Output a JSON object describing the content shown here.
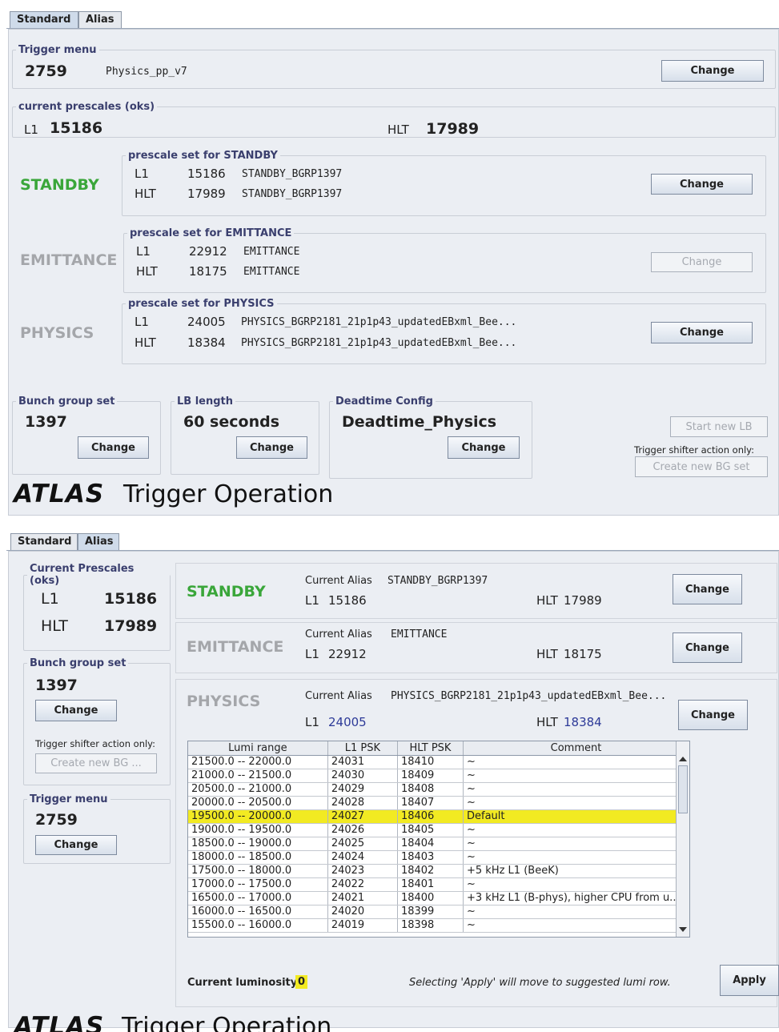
{
  "top": {
    "tabs": [
      "Standard",
      "Alias"
    ],
    "trigger_menu": {
      "legend": "Trigger menu",
      "id": "2759",
      "name": "Physics_pp_v7",
      "button": "Change"
    },
    "current_prescales": {
      "legend": "current prescales (oks)",
      "l1_label": "L1",
      "l1_value": "15186",
      "hlt_label": "HLT",
      "hlt_value": "17989"
    },
    "standby": {
      "state": "STANDBY",
      "legend": "prescale set for STANDBY",
      "l1_label": "L1",
      "l1_value": "15186",
      "l1_name": "STANDBY_BGRP1397",
      "hlt_label": "HLT",
      "hlt_value": "17989",
      "hlt_name": "STANDBY_BGRP1397",
      "button": "Change"
    },
    "emittance": {
      "state": "EMITTANCE",
      "legend": "prescale set for EMITTANCE",
      "l1_label": "L1",
      "l1_value": "22912",
      "l1_name": "EMITTANCE",
      "hlt_label": "HLT",
      "hlt_value": "18175",
      "hlt_name": "EMITTANCE",
      "button": "Change"
    },
    "physics": {
      "state": "PHYSICS",
      "legend": "prescale set for PHYSICS",
      "l1_label": "L1",
      "l1_value": "24005",
      "l1_name": "PHYSICS_BGRP2181_21p1p43_updatedEBxml_Bee...",
      "hlt_label": "HLT",
      "hlt_value": "18384",
      "hlt_name": "PHYSICS_BGRP2181_21p1p43_updatedEBxml_Bee...",
      "button": "Change"
    },
    "bunch_group": {
      "legend": "Bunch group set",
      "value": "1397",
      "button": "Change"
    },
    "lb_length": {
      "legend": "LB length",
      "value": "60 seconds",
      "button": "Change"
    },
    "deadtime": {
      "legend": "Deadtime Config",
      "value": "Deadtime_Physics",
      "button": "Change"
    },
    "start_new_lb": "Start new LB",
    "shifter_note": "Trigger shifter action only:",
    "create_bg": "Create new  BG set",
    "footer_logo": "ATLAS",
    "footer_title": "Trigger Operation"
  },
  "bottom": {
    "tabs": [
      "Standard",
      "Alias"
    ],
    "current_prescales": {
      "legend": "Current Prescales (oks)",
      "l1_label": "L1",
      "l1_value": "15186",
      "hlt_label": "HLT",
      "hlt_value": "17989"
    },
    "bunch_group": {
      "legend": "Bunch group set",
      "value": "1397",
      "button": "Change",
      "shifter_note": "Trigger shifter action only:",
      "create_bg": "Create new  BG ..."
    },
    "trigger_menu": {
      "legend": "Trigger menu",
      "value": "2759",
      "button": "Change"
    },
    "standby": {
      "state": "STANDBY",
      "alias_label": "Current Alias",
      "alias": "STANDBY_BGRP1397",
      "l1_label": "L1",
      "l1_value": "15186",
      "hlt_label": "HLT",
      "hlt_value": "17989",
      "button": "Change"
    },
    "emittance": {
      "state": "EMITTANCE",
      "alias_label": "Current Alias",
      "alias": "EMITTANCE",
      "l1_label": "L1",
      "l1_value": "22912",
      "hlt_label": "HLT",
      "hlt_value": "18175",
      "button": "Change"
    },
    "physics": {
      "state": "PHYSICS",
      "alias_label": "Current Alias",
      "alias": "PHYSICS_BGRP2181_21p1p43_updatedEBxml_Bee...",
      "l1_label": "L1",
      "l1_value": "24005",
      "hlt_label": "HLT",
      "hlt_value": "18384",
      "button": "Change"
    },
    "table": {
      "headers": [
        "Lumi range",
        "L1 PSK",
        "HLT PSK",
        "Comment"
      ],
      "rows": [
        [
          "21500.0 -- 22000.0",
          "24031",
          "18410",
          "~"
        ],
        [
          "21000.0 -- 21500.0",
          "24030",
          "18409",
          "~"
        ],
        [
          "20500.0 -- 21000.0",
          "24029",
          "18408",
          "~"
        ],
        [
          "20000.0 -- 20500.0",
          "24028",
          "18407",
          "~"
        ],
        [
          "19500.0 -- 20000.0",
          "24027",
          "18406",
          "Default"
        ],
        [
          "19000.0 -- 19500.0",
          "24026",
          "18405",
          "~"
        ],
        [
          "18500.0 -- 19000.0",
          "24025",
          "18404",
          "~"
        ],
        [
          "18000.0 -- 18500.0",
          "24024",
          "18403",
          "~"
        ],
        [
          "17500.0 -- 18000.0",
          "24023",
          "18402",
          "+5 kHz L1 (BeeK)"
        ],
        [
          "17000.0 -- 17500.0",
          "24022",
          "18401",
          "~"
        ],
        [
          "16500.0 -- 17000.0",
          "24021",
          "18400",
          "+3 kHz L1 (B-phys), higher CPU from u..."
        ],
        [
          "16000.0 -- 16500.0",
          "24020",
          "18399",
          "~"
        ],
        [
          "15500.0 -- 16000.0",
          "24019",
          "18398",
          "~"
        ]
      ],
      "selected_row": 4
    },
    "current_lumi_label": "Current luminosity",
    "current_lumi_value": "0",
    "apply_note": "Selecting 'Apply' will move to suggested lumi row.",
    "apply_button": "Apply",
    "footer_logo": "ATLAS",
    "footer_title": "Trigger Operation"
  },
  "colors": {
    "standby": "#3aa63a",
    "inactive": "#a4a6aa",
    "legend": "#3a3f6e",
    "alias_value": "#2d3a98",
    "selected_row": "#f2ea22"
  }
}
